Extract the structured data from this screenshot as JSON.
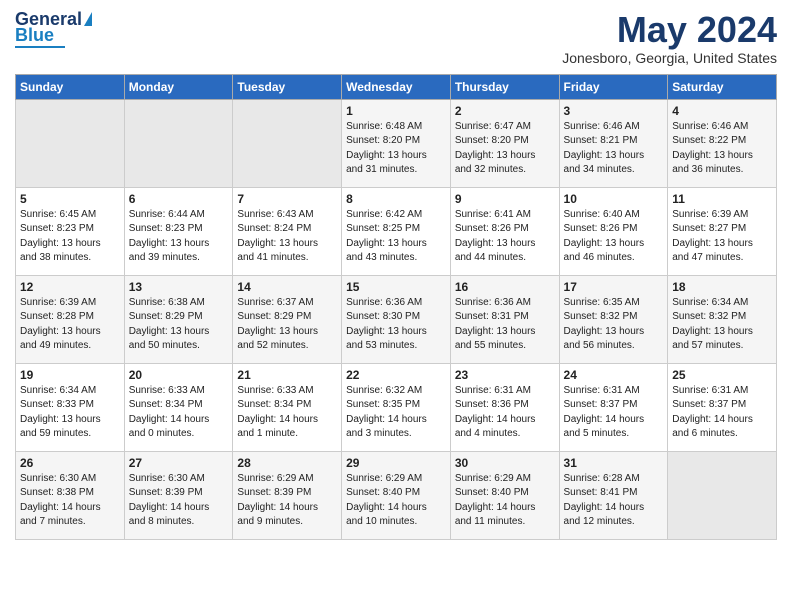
{
  "logo": {
    "general": "General",
    "blue": "Blue"
  },
  "header": {
    "month": "May 2024",
    "location": "Jonesboro, Georgia, United States"
  },
  "days_of_week": [
    "Sunday",
    "Monday",
    "Tuesday",
    "Wednesday",
    "Thursday",
    "Friday",
    "Saturday"
  ],
  "weeks": [
    [
      {
        "day": "",
        "info": ""
      },
      {
        "day": "",
        "info": ""
      },
      {
        "day": "",
        "info": ""
      },
      {
        "day": "1",
        "info": "Sunrise: 6:48 AM\nSunset: 8:20 PM\nDaylight: 13 hours\nand 31 minutes."
      },
      {
        "day": "2",
        "info": "Sunrise: 6:47 AM\nSunset: 8:20 PM\nDaylight: 13 hours\nand 32 minutes."
      },
      {
        "day": "3",
        "info": "Sunrise: 6:46 AM\nSunset: 8:21 PM\nDaylight: 13 hours\nand 34 minutes."
      },
      {
        "day": "4",
        "info": "Sunrise: 6:46 AM\nSunset: 8:22 PM\nDaylight: 13 hours\nand 36 minutes."
      }
    ],
    [
      {
        "day": "5",
        "info": "Sunrise: 6:45 AM\nSunset: 8:23 PM\nDaylight: 13 hours\nand 38 minutes."
      },
      {
        "day": "6",
        "info": "Sunrise: 6:44 AM\nSunset: 8:23 PM\nDaylight: 13 hours\nand 39 minutes."
      },
      {
        "day": "7",
        "info": "Sunrise: 6:43 AM\nSunset: 8:24 PM\nDaylight: 13 hours\nand 41 minutes."
      },
      {
        "day": "8",
        "info": "Sunrise: 6:42 AM\nSunset: 8:25 PM\nDaylight: 13 hours\nand 43 minutes."
      },
      {
        "day": "9",
        "info": "Sunrise: 6:41 AM\nSunset: 8:26 PM\nDaylight: 13 hours\nand 44 minutes."
      },
      {
        "day": "10",
        "info": "Sunrise: 6:40 AM\nSunset: 8:26 PM\nDaylight: 13 hours\nand 46 minutes."
      },
      {
        "day": "11",
        "info": "Sunrise: 6:39 AM\nSunset: 8:27 PM\nDaylight: 13 hours\nand 47 minutes."
      }
    ],
    [
      {
        "day": "12",
        "info": "Sunrise: 6:39 AM\nSunset: 8:28 PM\nDaylight: 13 hours\nand 49 minutes."
      },
      {
        "day": "13",
        "info": "Sunrise: 6:38 AM\nSunset: 8:29 PM\nDaylight: 13 hours\nand 50 minutes."
      },
      {
        "day": "14",
        "info": "Sunrise: 6:37 AM\nSunset: 8:29 PM\nDaylight: 13 hours\nand 52 minutes."
      },
      {
        "day": "15",
        "info": "Sunrise: 6:36 AM\nSunset: 8:30 PM\nDaylight: 13 hours\nand 53 minutes."
      },
      {
        "day": "16",
        "info": "Sunrise: 6:36 AM\nSunset: 8:31 PM\nDaylight: 13 hours\nand 55 minutes."
      },
      {
        "day": "17",
        "info": "Sunrise: 6:35 AM\nSunset: 8:32 PM\nDaylight: 13 hours\nand 56 minutes."
      },
      {
        "day": "18",
        "info": "Sunrise: 6:34 AM\nSunset: 8:32 PM\nDaylight: 13 hours\nand 57 minutes."
      }
    ],
    [
      {
        "day": "19",
        "info": "Sunrise: 6:34 AM\nSunset: 8:33 PM\nDaylight: 13 hours\nand 59 minutes."
      },
      {
        "day": "20",
        "info": "Sunrise: 6:33 AM\nSunset: 8:34 PM\nDaylight: 14 hours\nand 0 minutes."
      },
      {
        "day": "21",
        "info": "Sunrise: 6:33 AM\nSunset: 8:34 PM\nDaylight: 14 hours\nand 1 minute."
      },
      {
        "day": "22",
        "info": "Sunrise: 6:32 AM\nSunset: 8:35 PM\nDaylight: 14 hours\nand 3 minutes."
      },
      {
        "day": "23",
        "info": "Sunrise: 6:31 AM\nSunset: 8:36 PM\nDaylight: 14 hours\nand 4 minutes."
      },
      {
        "day": "24",
        "info": "Sunrise: 6:31 AM\nSunset: 8:37 PM\nDaylight: 14 hours\nand 5 minutes."
      },
      {
        "day": "25",
        "info": "Sunrise: 6:31 AM\nSunset: 8:37 PM\nDaylight: 14 hours\nand 6 minutes."
      }
    ],
    [
      {
        "day": "26",
        "info": "Sunrise: 6:30 AM\nSunset: 8:38 PM\nDaylight: 14 hours\nand 7 minutes."
      },
      {
        "day": "27",
        "info": "Sunrise: 6:30 AM\nSunset: 8:39 PM\nDaylight: 14 hours\nand 8 minutes."
      },
      {
        "day": "28",
        "info": "Sunrise: 6:29 AM\nSunset: 8:39 PM\nDaylight: 14 hours\nand 9 minutes."
      },
      {
        "day": "29",
        "info": "Sunrise: 6:29 AM\nSunset: 8:40 PM\nDaylight: 14 hours\nand 10 minutes."
      },
      {
        "day": "30",
        "info": "Sunrise: 6:29 AM\nSunset: 8:40 PM\nDaylight: 14 hours\nand 11 minutes."
      },
      {
        "day": "31",
        "info": "Sunrise: 6:28 AM\nSunset: 8:41 PM\nDaylight: 14 hours\nand 12 minutes."
      },
      {
        "day": "",
        "info": ""
      }
    ]
  ]
}
